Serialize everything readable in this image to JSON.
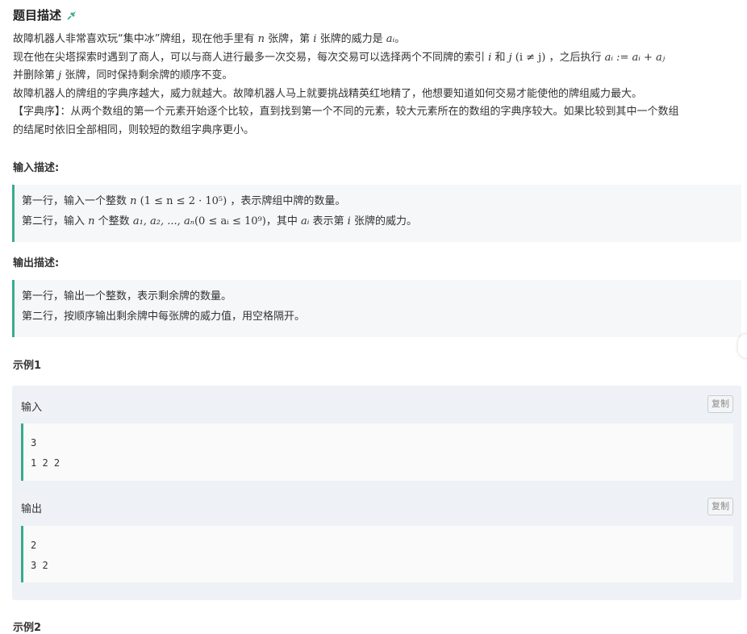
{
  "problem": {
    "title": "题目描述",
    "pin_icon": "pin-icon",
    "desc": {
      "l1_a": "故障机器人非常喜欢玩“集中冰”牌组，现在他手里有",
      "l1_n": "n",
      "l1_b": "张牌，第",
      "l1_i": "i",
      "l1_c": "张牌的威力是",
      "l1_ai": "aᵢ",
      "l1_d": "。",
      "l2_a": "现在他在尖塔探索时遇到了商人，可以与商人进行最多一次交易，每次交易可以选择两个不同牌的索引",
      "l2_i": "i",
      "l2_b": "和",
      "l2_j": "j",
      "l2_cond": "(i ≠ j)",
      "l2_c": "，之后执行",
      "l2_assign": "aᵢ := aᵢ + aⱼ",
      "l3_a": "并删除第",
      "l3_j": "j",
      "l3_b": "张牌，同时保持剩余牌的顺序不变。",
      "l4": "故障机器人的牌组的字典序越大，威力就越大。故障机器人马上就要挑战精英红地精了，他想要知道如何交易才能使他的牌组威力最大。",
      "l5": "【字典序】：从两个数组的第一个元素开始逐个比较，直到找到第一个不同的元素，较大元素所在的数组的字典序较大。如果比较到其中一个数组",
      "l6": "的结尾时依旧全部相同，则较短的数组字典序更小。"
    },
    "input_title": "输入描述:",
    "input": {
      "l1_a": "第一行，输入一个整数",
      "l1_n": "n",
      "l1_range": "(1 ≤ n ≤ 2 · 10⁵)",
      "l1_b": "，表示牌组中牌的数量。",
      "l2_a": "第二行，输入",
      "l2_n": "n",
      "l2_b": "个整数",
      "l2_seq": "a₁, a₂, ..., aₙ",
      "l2_range": "(0 ≤ aᵢ ≤ 10⁹)",
      "l2_c": "，其中",
      "l2_ai": "aᵢ",
      "l2_d": "表示第",
      "l2_i": "i",
      "l2_e": "张牌的威力。"
    },
    "output_title": "输出描述:",
    "output": {
      "l1": "第一行，输出一个整数，表示剩余牌的数量。",
      "l2": "第二行，按顺序输出剩余牌中每张牌的威力值，用空格隔开。"
    },
    "example1_title": "示例1",
    "example1": {
      "input_label": "输入",
      "copy_label": "复制",
      "input_lines": [
        "3",
        "1 2 2"
      ],
      "output_label": "输出",
      "output_lines": [
        "2",
        "3 2"
      ]
    },
    "example2_title": "示例2"
  }
}
